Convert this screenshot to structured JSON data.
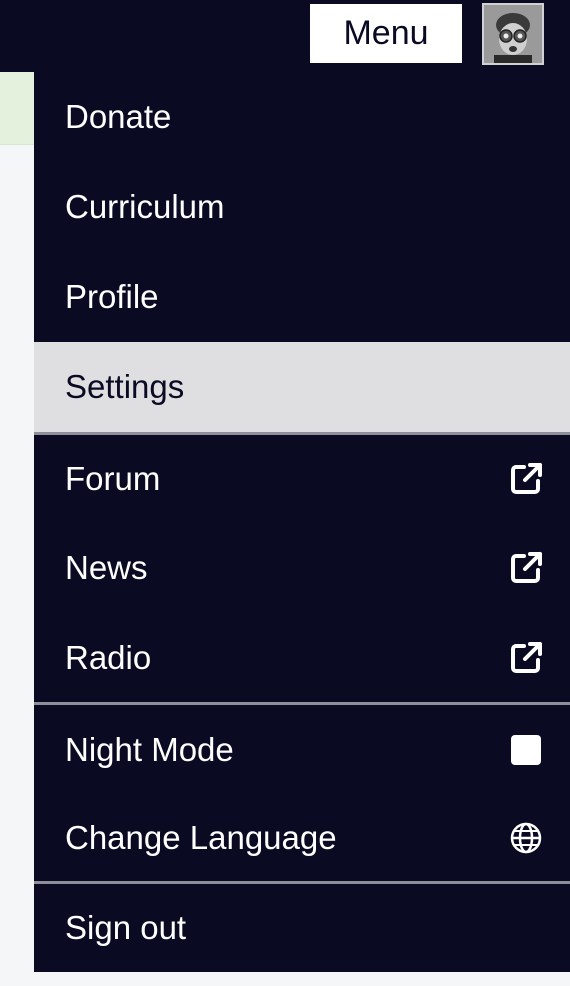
{
  "header": {
    "menu_label": "Menu"
  },
  "menu": {
    "items": [
      {
        "label": "Donate"
      },
      {
        "label": "Curriculum"
      },
      {
        "label": "Profile"
      },
      {
        "label": "Settings",
        "active": true
      },
      {
        "label": "Forum",
        "icon": "external-link-icon"
      },
      {
        "label": "News",
        "icon": "external-link-icon"
      },
      {
        "label": "Radio",
        "icon": "external-link-icon"
      },
      {
        "label": "Night Mode",
        "icon": "checkbox",
        "checked": false
      },
      {
        "label": "Change Language",
        "icon": "globe-icon"
      },
      {
        "label": "Sign out"
      }
    ]
  },
  "colors": {
    "nav_bg": "#0a0a23",
    "active_bg": "#dfdfe2",
    "text_light": "#ffffff",
    "divider": "#8f8f9a"
  }
}
